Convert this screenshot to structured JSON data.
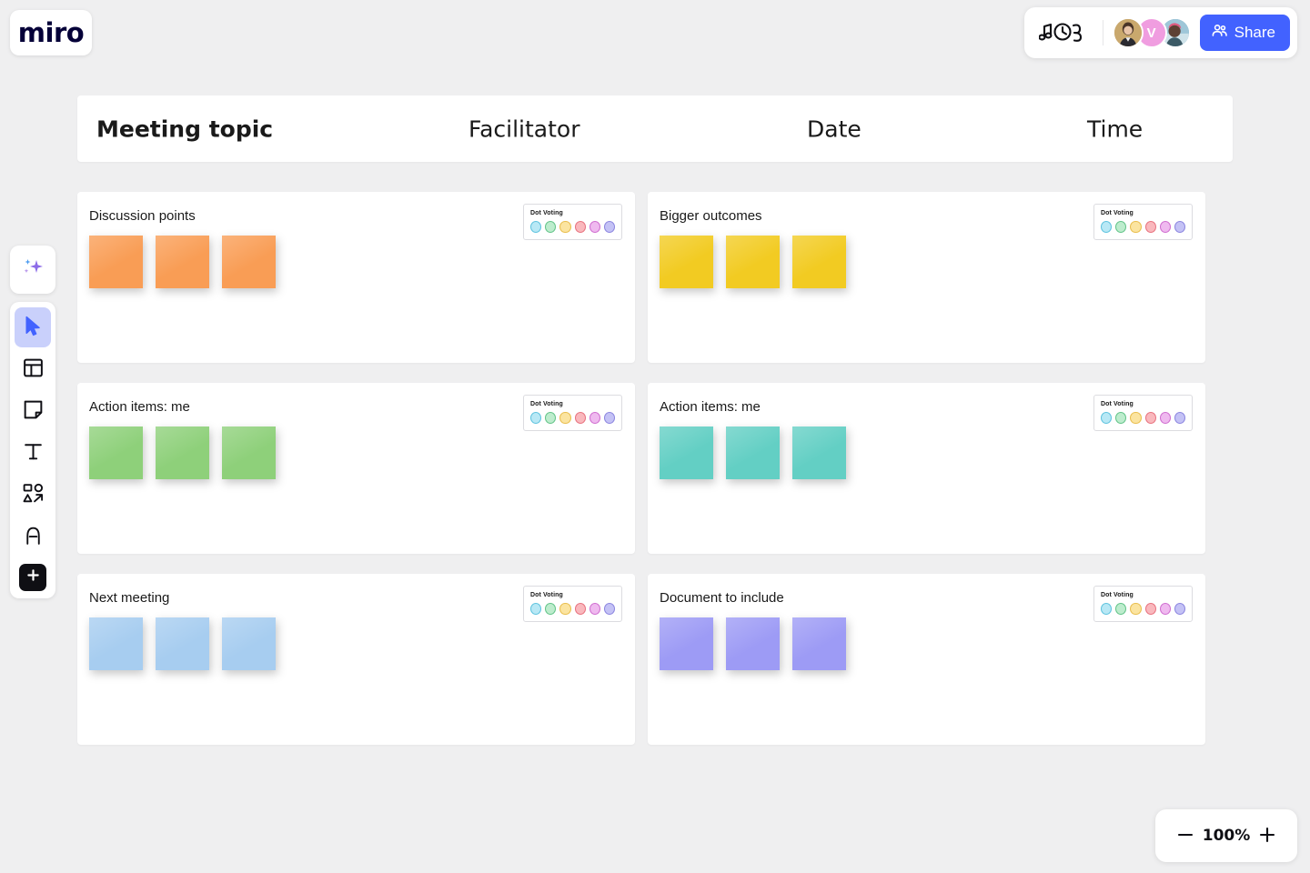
{
  "app": {
    "logo_text": "miro"
  },
  "topbar": {
    "music_icon": "music-notes-icon",
    "collaborators": [
      {
        "type": "photo",
        "name": "collaborator-1",
        "bg": "#c8a66b"
      },
      {
        "type": "initial",
        "name": "collaborator-2",
        "initial": "V",
        "bg": "#f09de0"
      },
      {
        "type": "photo",
        "name": "collaborator-3",
        "bg": "#7fb2c9"
      }
    ],
    "share_label": "Share",
    "share_color": "#4262ff"
  },
  "toolbar": {
    "ai_icon": "ai-sparkle-icon",
    "tools": [
      {
        "name": "select-tool",
        "icon": "cursor-icon",
        "active": true
      },
      {
        "name": "template-tool",
        "icon": "template-frame-icon",
        "active": false
      },
      {
        "name": "sticky-note-tool",
        "icon": "sticky-note-icon",
        "active": false
      },
      {
        "name": "text-tool",
        "icon": "text-t-icon",
        "active": false
      },
      {
        "name": "shapes-tool",
        "icon": "shapes-connector-icon",
        "active": false
      },
      {
        "name": "pen-tool",
        "icon": "pen-draw-icon",
        "active": false
      }
    ],
    "more_label": "plus-icon"
  },
  "header": {
    "columns": [
      "Meeting topic",
      "Facilitator",
      "Date",
      "Time"
    ]
  },
  "dot_voting": {
    "label": "Dot Voting",
    "colors": [
      "#b8e8f5",
      "#bdeccd",
      "#fbe4a0",
      "#f9b8bd",
      "#efb9ef",
      "#c4c2f5"
    ],
    "border_colors": [
      "#5fc3de",
      "#63c489",
      "#e9be4e",
      "#e8727f",
      "#d06ed0",
      "#8c86e0"
    ]
  },
  "sections": [
    {
      "id": "discussion-points",
      "title": "Discussion points",
      "note_color": "#f99d55",
      "note_count": 3
    },
    {
      "id": "bigger-outcomes",
      "title": "Bigger outcomes",
      "note_color": "#f2cb22",
      "note_count": 3
    },
    {
      "id": "action-items-me-left",
      "title": "Action items: me",
      "note_color": "#8ed07a",
      "note_count": 3
    },
    {
      "id": "action-items-me-right",
      "title": "Action items: me",
      "note_color": "#63cfc4",
      "note_count": 3
    },
    {
      "id": "next-meeting",
      "title": "Next meeting",
      "note_color": "#a7cdf0",
      "note_count": 3
    },
    {
      "id": "document-to-include",
      "title": "Document to include",
      "note_color": "#9d9bf5",
      "note_count": 3
    }
  ],
  "zoom_control": {
    "zoom_out_label": "zoom-out-icon",
    "level": "100%",
    "zoom_in_label": "zoom-in-icon"
  }
}
